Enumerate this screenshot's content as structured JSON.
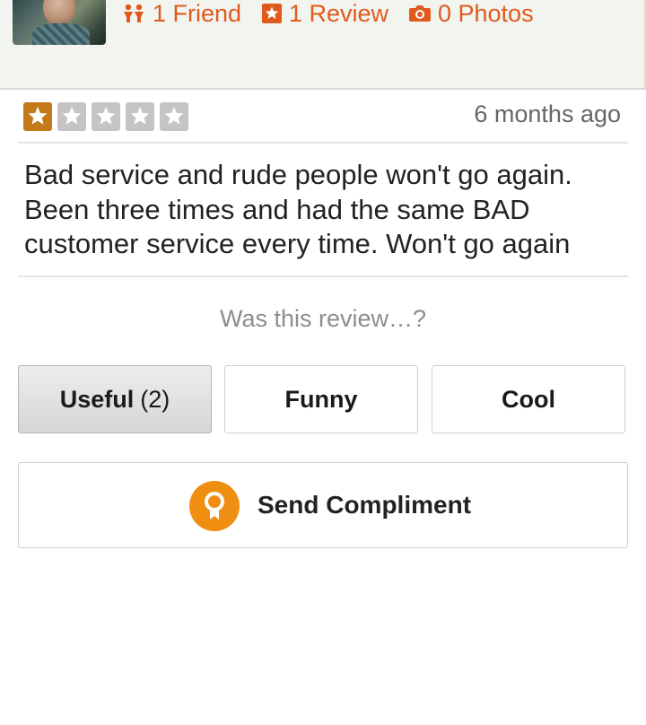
{
  "profile": {
    "friends_count": "1 Friend",
    "reviews_count": "1 Review",
    "photos_count": "0 Photos"
  },
  "review": {
    "rating": 1,
    "max_rating": 5,
    "timestamp": "6 months ago",
    "text_lines": [
      "Bad service and rude people won't go again.",
      "Been three times and had the same BAD",
      "customer service every time. Won't go again"
    ]
  },
  "feedback": {
    "prompt": "Was this review…?",
    "useful_label": "Useful",
    "useful_count": "(2)",
    "funny_label": "Funny",
    "cool_label": "Cool"
  },
  "compliment": {
    "label": "Send Compliment"
  },
  "colors": {
    "accent": "#e05a1c",
    "star_filled": "#c57a1a",
    "star_empty": "#c4c4c4",
    "compliment_icon": "#f08e12"
  },
  "icons": {
    "friends": "friends-icon",
    "review": "review-star-icon",
    "photos": "camera-icon",
    "star": "star-icon",
    "compliment": "award-ribbon-icon"
  }
}
